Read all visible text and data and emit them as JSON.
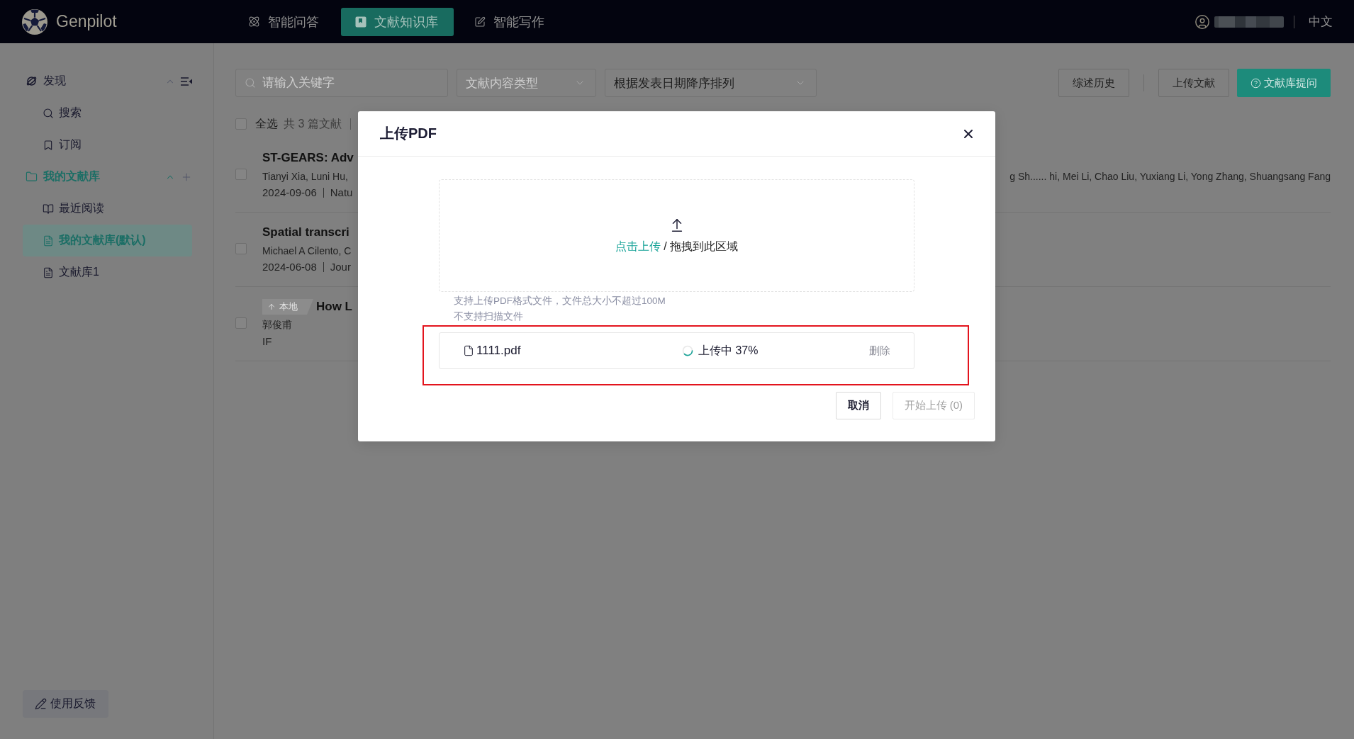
{
  "header": {
    "logo": "Genpilot",
    "nav": [
      {
        "label": "智能问答",
        "selected": false
      },
      {
        "label": "文献知识库",
        "selected": true
      },
      {
        "label": "智能写作",
        "selected": false
      }
    ],
    "language": "中文"
  },
  "sidebar": {
    "sections": [
      {
        "kind": "discover",
        "label": "发现",
        "active": false,
        "expanded": true,
        "items": [
          {
            "label": "搜索",
            "selected": false
          },
          {
            "label": "订阅",
            "selected": false
          }
        ]
      },
      {
        "kind": "library",
        "label": "我的文献库",
        "active": true,
        "expanded": true,
        "items": [
          {
            "label": "最近阅读",
            "selected": false
          },
          {
            "label": "我的文献库(默认)",
            "selected": true
          },
          {
            "label": "文献库1",
            "selected": false
          }
        ]
      }
    ],
    "feedback": "使用反馈"
  },
  "toolbar": {
    "search": {
      "placeholder": "请输入关键字"
    },
    "filters": [
      {
        "placeholder": "文献内容类型"
      },
      {
        "value": "根据发表日期降序排列"
      }
    ],
    "buttons": [
      {
        "label": "综述历史",
        "kind": "default"
      },
      {
        "label": "上传文献",
        "kind": "default"
      },
      {
        "label": "文献库提问",
        "kind": "primary"
      }
    ]
  },
  "selection": {
    "label": "全选",
    "count": "共 3 篇文献",
    "checked": false
  },
  "papers": [
    {
      "title": "ST-GEARS: Adv",
      "authors": "Tianyi Xia, Luni Hu,",
      "authors_end": "g Sh...... hi, Mei Li, Chao Liu, Yuxiang Li, Yong Zhang, Shuangsang Fang",
      "date": "2024-09-06",
      "source": "Natu",
      "checked": false
    },
    {
      "title": "Spatial transcri",
      "authors": "Michael A Cilento, C",
      "date": "2024-06-08",
      "source": "Jour",
      "checked": false
    },
    {
      "badge": "本地",
      "title": "How L",
      "authors": "郭俊甫",
      "note": "IF",
      "checked": false
    }
  ],
  "upload_dialog": {
    "title": "上传PDF",
    "dropzone": {
      "link": "点击上传",
      "text": "/ 拖拽到此区域"
    },
    "hints": [
      "支持上传PDF格式文件，文件总大小不超过100M",
      "不支持扫描文件"
    ],
    "highlighted": true,
    "files": [
      {
        "name": "1111.pdf",
        "uploading": true,
        "status": "上传中 37%",
        "action": "删除"
      }
    ],
    "buttons": [
      {
        "label": "取消",
        "kind": "cancel",
        "disabled": false
      },
      {
        "label": "开始上传 (0)",
        "kind": "submit",
        "disabled": true
      }
    ]
  }
}
